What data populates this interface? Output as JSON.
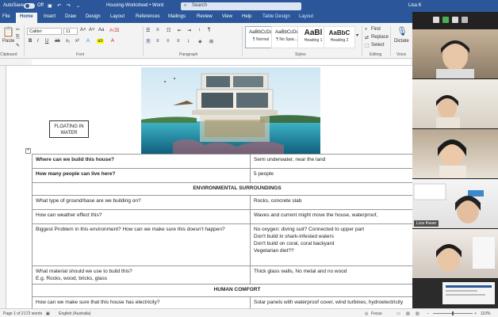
{
  "titlebar": {
    "autosave_label": "AutoSave",
    "autosave_state": "Off",
    "doc_title": "Housing-Worksheet • Word",
    "search_placeholder": "Search",
    "user": "Lisa K"
  },
  "tabs": [
    {
      "label": "File"
    },
    {
      "label": "Home"
    },
    {
      "label": "Insert"
    },
    {
      "label": "Draw"
    },
    {
      "label": "Design"
    },
    {
      "label": "Layout"
    },
    {
      "label": "References"
    },
    {
      "label": "Mailings"
    },
    {
      "label": "Review"
    },
    {
      "label": "View"
    },
    {
      "label": "Help"
    },
    {
      "label": "Table Design"
    },
    {
      "label": "Layout"
    }
  ],
  "ribbon": {
    "clipboard": {
      "paste": "Paste",
      "label": "Clipboard"
    },
    "font": {
      "name": "Calibri",
      "size": "11",
      "label": "Font"
    },
    "paragraph": {
      "label": "Paragraph"
    },
    "styles": {
      "label": "Styles",
      "items": [
        {
          "sample": "AaBbCcDd",
          "name": "¶ Normal"
        },
        {
          "sample": "AaBbCcDd",
          "name": "¶ No Spac..."
        },
        {
          "sample": "AaBl",
          "name": "Heading 1"
        },
        {
          "sample": "AaBbC",
          "name": "Heading 2"
        }
      ]
    },
    "editing": {
      "find": "Find",
      "replace": "Replace",
      "select": "Select",
      "label": "Editing"
    },
    "voice": {
      "dictate": "Dictate",
      "label": "Voice"
    }
  },
  "document": {
    "float_label_1": "FLOATING IN",
    "float_label_2": "WATER",
    "rows": [
      {
        "q": "Where can we build this house?",
        "a": "Semi underwater, near the land",
        "bold": true
      },
      {
        "q": "How many people can live here?",
        "a": "5 people",
        "bold": true
      },
      {
        "heading": "ENVIRONMENTAL SURROUNDINGS"
      },
      {
        "q": "What type of ground/base are we building on?",
        "a": "Rocks, concrete slab"
      },
      {
        "q": "How can weather effect this?",
        "a": "Waves and current might move the house, waterproof,"
      },
      {
        "q": "Biggest Problem in this environment? How can we make sure this doesn't happen?",
        "a1": "No oxygen: diving suit? Connected to upper part",
        "a2": "Don't build in shark-infested waters",
        "a3": "Don't build on coral, coral backyard",
        "a4": "Vegetarian diet??"
      },
      {
        "q": "What material should we use to build this?",
        "q2": "E.g. Rocks, wood, bricks, glass",
        "a": "Thick glass walls, No metal and no wood"
      },
      {
        "heading": "HUMAN COMFORT"
      },
      {
        "q": "How can we make sure that this house has electricity?",
        "a": "Solar panels with waterproof cover, wind turbines, hydroelectricity"
      }
    ]
  },
  "status": {
    "page": "Page 1 of 2",
    "words": "172 words",
    "language": "English (Australia)",
    "focus": "Focus",
    "zoom": "110%"
  },
  "video": {
    "participant_name": "Liza Kwan"
  }
}
